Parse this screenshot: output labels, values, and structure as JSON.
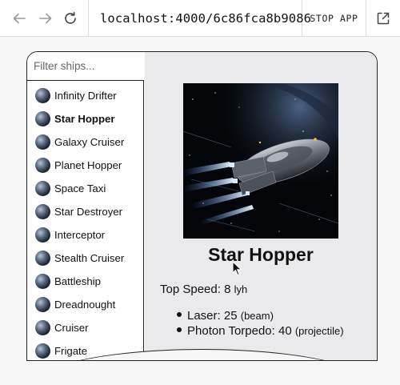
{
  "browser": {
    "url": "localhost:4000/6c86fca8b9086",
    "stop_label": "STOP APP",
    "back_icon": "arrow-left-icon",
    "forward_icon": "arrow-right-icon",
    "reload_icon": "reload-icon",
    "popout_icon": "external-link-icon"
  },
  "sidebar": {
    "filter_placeholder": "Filter ships...",
    "ships": [
      {
        "name": "Infinity Drifter",
        "active": false
      },
      {
        "name": "Star Hopper",
        "active": true
      },
      {
        "name": "Galaxy Cruiser",
        "active": false
      },
      {
        "name": "Planet Hopper",
        "active": false
      },
      {
        "name": "Space Taxi",
        "active": false
      },
      {
        "name": "Star Destroyer",
        "active": false
      },
      {
        "name": "Interceptor",
        "active": false
      },
      {
        "name": "Stealth Cruiser",
        "active": false
      },
      {
        "name": "Battleship",
        "active": false
      },
      {
        "name": "Dreadnought",
        "active": false
      },
      {
        "name": "Cruiser",
        "active": false
      },
      {
        "name": "Frigate",
        "active": false
      }
    ]
  },
  "detail": {
    "name": "Star Hopper",
    "top_speed_label": "Top Speed:",
    "top_speed_value": "8",
    "top_speed_unit": "lyh",
    "weapons": [
      {
        "name": "Laser:",
        "value": "25",
        "type": "(beam)"
      },
      {
        "name": "Photon Torpedo:",
        "value": "40",
        "type": "(projectile)"
      }
    ]
  }
}
